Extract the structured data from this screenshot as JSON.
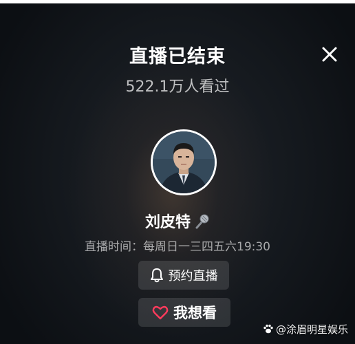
{
  "header": {
    "title": "直播已结束",
    "viewer_count": "522.1万人看过",
    "close_icon": "close-icon"
  },
  "host": {
    "name": "刘皮特",
    "name_icon": "microphone-icon",
    "schedule": "直播时间：每周日一三四五六19:30"
  },
  "actions": {
    "reserve_label": "预约直播",
    "reserve_icon": "bell-icon",
    "want_label": "我想看",
    "want_icon": "heart-outline-icon",
    "heart_color": "#ff3b5c"
  },
  "watermark": {
    "text": "@涂眉明星娱乐"
  },
  "colors": {
    "background": "#14181d",
    "button_bg": "rgba(255,255,255,0.12)"
  }
}
